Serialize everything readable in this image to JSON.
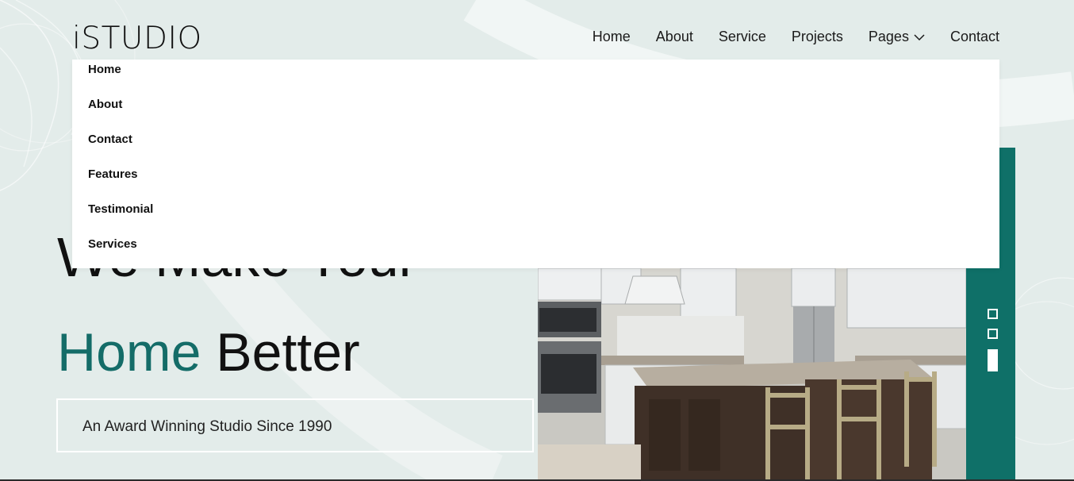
{
  "header": {
    "logo": "iSTUDIO",
    "nav": [
      {
        "label": "Home"
      },
      {
        "label": "About"
      },
      {
        "label": "Service"
      },
      {
        "label": "Projects"
      },
      {
        "label": "Pages",
        "icon": "chevron-down-icon"
      },
      {
        "label": "Contact"
      }
    ]
  },
  "dropdown": {
    "items": [
      "Home",
      "About",
      "Contact",
      "Features",
      "Testimonial",
      "Services"
    ]
  },
  "hero": {
    "line1": "We Make Your",
    "line2_accent": "Home",
    "line2_rest": " Better",
    "tagline": "An Award Winning Studio Since 1990"
  },
  "slider": {
    "dots": 3,
    "active_index": 2
  },
  "colors": {
    "accent": "#146c68",
    "teal_bar": "#0f7068",
    "background": "#e3ecea"
  }
}
